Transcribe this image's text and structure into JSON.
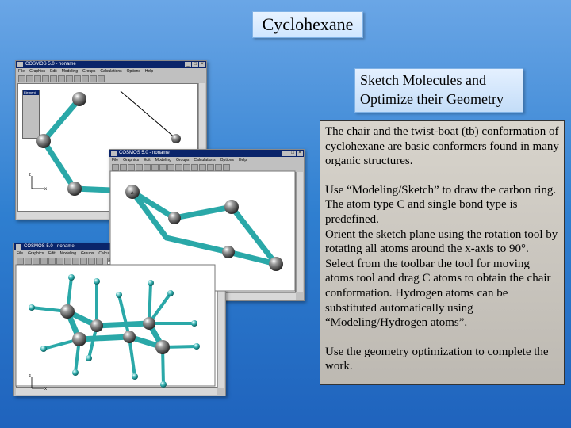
{
  "title": "Cyclohexane",
  "subtitle": {
    "line1": "Sketch Molecules and",
    "line2": "Optimize their Geometry"
  },
  "panel": {
    "p1": "The chair and the twist-boat (tb) conformation of cyclohexane are basic conformers found in many organic structures.",
    "p2": "Use “Modeling/Sketch” to draw the carbon ring.  The atom type C and single bond type is predefined.",
    "p3": "Orient the sketch plane using the rotation tool by rotating all atoms around the x-axis to 90°.",
    "p4": "Select from the toolbar the tool for moving atoms tool and drag C atoms to obtain the chair conformation. Hydrogen atoms can be substituted automatically using “Modeling/Hydrogen atoms”.",
    "p5": "Use the geometry optimization to complete the work."
  },
  "window": {
    "title": "COSMOS 5.0 - noname",
    "menus": [
      "File",
      "Graphics",
      "Edit",
      "Modeling",
      "Groups",
      "Calculations",
      "Options",
      "Help"
    ],
    "toolbar_field": "8"
  },
  "palette": {
    "title": "Element"
  },
  "axis": {
    "x": "x",
    "z": "z"
  },
  "colors": {
    "bond": "#2aa8a8",
    "atom": "#606060",
    "background_top": "#6aa6e6",
    "background_bottom": "#1f63bd"
  }
}
